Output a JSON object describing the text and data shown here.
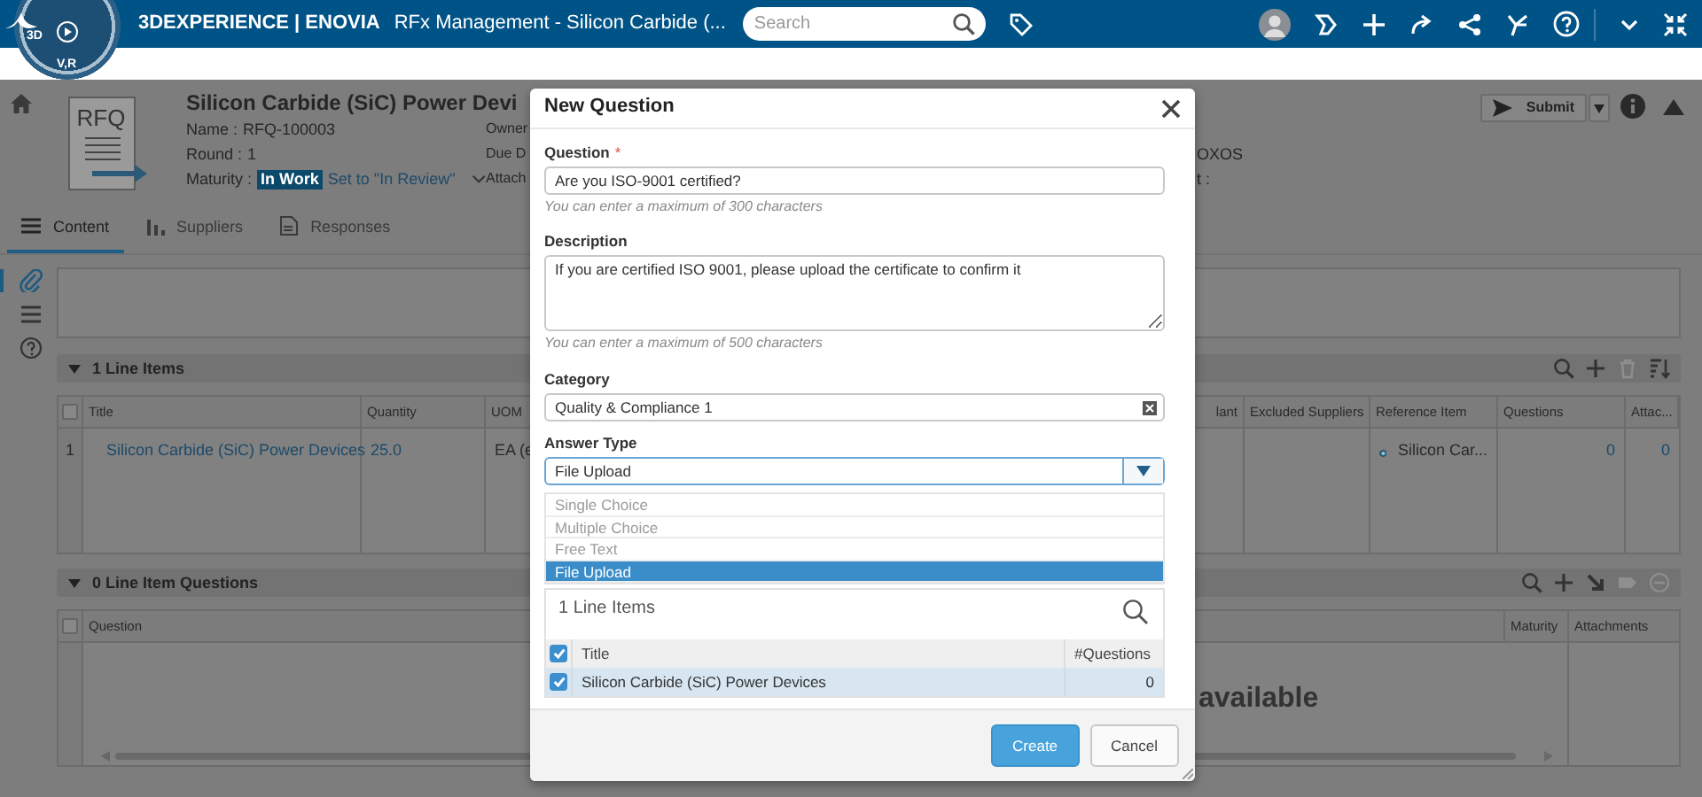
{
  "top_bar": {
    "compass": {
      "left": "3D",
      "bottom": "V,R"
    },
    "brand": "3DEXPERIENCE | ENOVIA",
    "app_title": "RFx Management - Silicon Carbide (...",
    "search": {
      "placeholder": "Search"
    }
  },
  "header": {
    "document_label": "RFQ",
    "title": "Silicon Carbide (SiC) Power Devi",
    "fields": [
      {
        "label": "Name :",
        "value": "RFQ-100003"
      },
      {
        "label": "Round :",
        "value": "1"
      }
    ],
    "maturity": {
      "label": "Maturity :",
      "state": "In Work",
      "action": "Set to \"In Review\""
    },
    "more_labels": [
      "Owner",
      "Due D",
      "Attach"
    ],
    "right_texts": [
      "OXOS",
      "t :"
    ],
    "submit": "Submit"
  },
  "tabs": [
    {
      "label": "Content",
      "kind": "list",
      "selected": true
    },
    {
      "label": "Suppliers",
      "kind": "chart",
      "selected": false
    },
    {
      "label": "Responses",
      "kind": "document",
      "selected": false
    }
  ],
  "side_icons": [
    {
      "kind": "attachment",
      "selected": true
    },
    {
      "kind": "list",
      "selected": false
    },
    {
      "kind": "help",
      "selected": false
    }
  ],
  "line_items": {
    "title": "1 Line Items",
    "expanded": true,
    "all_checked": false,
    "tools": [
      {
        "kind": "search",
        "disabled": false
      },
      {
        "kind": "plus",
        "disabled": false
      },
      {
        "kind": "trash",
        "disabled": true
      },
      {
        "kind": "sort",
        "disabled": false
      }
    ],
    "columns": [
      "Title",
      "Quantity",
      "UOM",
      "lant",
      "Excluded Suppliers",
      "Reference Item",
      "Questions",
      "Attac..."
    ],
    "rows": [
      {
        "number": "1",
        "title": "Silicon Carbide (SiC) Power Devices",
        "quantity": "25.0",
        "uom": "EA (e",
        "reference": "Silicon Car...",
        "questions": "0",
        "attachments": "0"
      }
    ]
  },
  "questions": {
    "title": "0 Line Item Questions",
    "expanded": true,
    "all_checked": false,
    "tools": [
      {
        "kind": "search",
        "disabled": false
      },
      {
        "kind": "plus",
        "disabled": false
      },
      {
        "kind": "arrow",
        "disabled": false
      },
      {
        "kind": "tag",
        "disabled": true
      },
      {
        "kind": "minus",
        "disabled": true
      }
    ],
    "columns": [
      "Question",
      "Maturity",
      "Attachments"
    ],
    "empty_message": "available"
  },
  "modal": {
    "title": "New Question",
    "fields": [
      {
        "kind": "text",
        "label": "Question",
        "required_mark": "*",
        "value": "Are you ISO-9001 certified?",
        "hint": "You can enter a maximum of 300 characters"
      },
      {
        "kind": "textarea",
        "label": "Description",
        "value": "If you are certified ISO 9001, please upload the certificate to confirm it",
        "hint": "You can enter a maximum of 500 characters"
      },
      {
        "kind": "clearable",
        "label": "Category",
        "value": "Quality & Compliance 1"
      },
      {
        "kind": "select",
        "label": "Answer Type",
        "value": "File Upload",
        "expanded": true,
        "options": [
          {
            "label": "Single Choice",
            "selected": false
          },
          {
            "label": "Multiple Choice",
            "selected": false
          },
          {
            "label": "Free Text",
            "selected": false
          },
          {
            "label": "File Upload",
            "selected": true
          }
        ]
      }
    ],
    "line_items": {
      "title": "1 Line Items",
      "all_checked": true,
      "columns": [
        "Title",
        "#Questions"
      ],
      "rows": [
        {
          "title": "Silicon Carbide (SiC) Power Devices",
          "questions": "0",
          "checked": true,
          "selected": true
        }
      ]
    },
    "buttons": [
      {
        "label": "Create",
        "kind": "primary"
      },
      {
        "label": "Cancel",
        "kind": "secondary"
      }
    ]
  }
}
